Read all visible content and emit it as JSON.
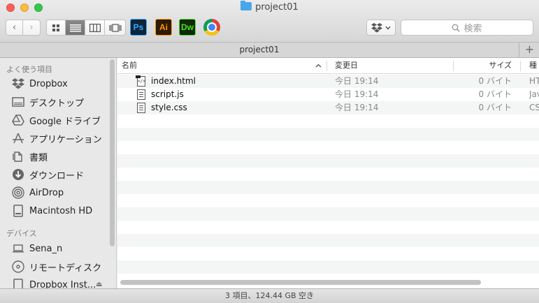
{
  "window": {
    "title": "project01"
  },
  "toolbar": {
    "back": "‹",
    "forward": "›",
    "apps": {
      "ps": "Ps",
      "ai": "Ai",
      "dw": "Dw"
    },
    "search_placeholder": "検索"
  },
  "tabs": {
    "active": "project01",
    "add": "+"
  },
  "sidebar": {
    "favorites_header": "よく使う項目",
    "favorites": [
      {
        "label": "Dropbox",
        "icon": "dropbox-icon"
      },
      {
        "label": "デスクトップ",
        "icon": "desktop-icon"
      },
      {
        "label": "Google ドライブ",
        "icon": "google-drive-icon"
      },
      {
        "label": "アプリケーション",
        "icon": "applications-icon"
      },
      {
        "label": "書類",
        "icon": "documents-icon"
      },
      {
        "label": "ダウンロード",
        "icon": "download-icon"
      },
      {
        "label": "AirDrop",
        "icon": "airdrop-icon"
      },
      {
        "label": "Macintosh HD",
        "icon": "hard-drive-icon"
      }
    ],
    "devices_header": "デバイス",
    "devices": [
      {
        "label": "Sena_n",
        "icon": "laptop-icon"
      },
      {
        "label": "リモートディスク",
        "icon": "disc-icon"
      },
      {
        "label": "Dropbox Inst...",
        "icon": "disk-image-icon"
      }
    ]
  },
  "columns": {
    "name": "名前",
    "date": "変更日",
    "size": "サイズ",
    "kind": "種類"
  },
  "files": [
    {
      "name": "index.html",
      "date": "今日 19:14",
      "size": "0 バイト",
      "kind": "HTML"
    },
    {
      "name": "script.js",
      "date": "今日 19:14",
      "size": "0 バイト",
      "kind": "JavaScript"
    },
    {
      "name": "style.css",
      "date": "今日 19:14",
      "size": "0 バイト",
      "kind": "CSS"
    }
  ],
  "status": "3 項目、124.44 GB 空き"
}
